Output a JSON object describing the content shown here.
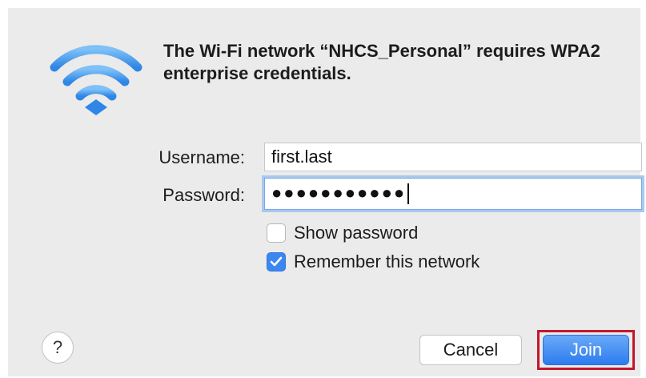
{
  "dialog": {
    "title": "The Wi-Fi network “NHCS_Personal” requires WPA2 enterprise credentials.",
    "icon": "wifi-icon"
  },
  "form": {
    "username_label": "Username:",
    "username_value": "first.last",
    "password_label": "Password:",
    "password_masked": "●●●●●●●●●●●"
  },
  "options": {
    "show_password_label": "Show password",
    "show_password_checked": false,
    "remember_label": "Remember this network",
    "remember_checked": true
  },
  "buttons": {
    "help_label": "?",
    "cancel_label": "Cancel",
    "join_label": "Join"
  },
  "colors": {
    "accent": "#3b86f0",
    "highlight_border": "#c4172c",
    "dialog_bg": "#ebebeb"
  }
}
